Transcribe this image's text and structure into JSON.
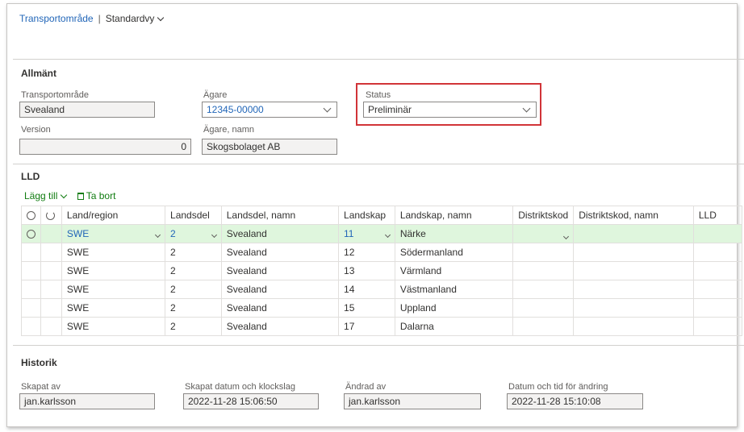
{
  "breadcrumb": {
    "entity": "Transportområde",
    "separator": "|",
    "view": "Standardvy"
  },
  "general": {
    "title": "Allmänt",
    "transport_area": {
      "label": "Transportområde",
      "value": "Svealand"
    },
    "version": {
      "label": "Version",
      "value": "0"
    },
    "owner": {
      "label": "Ägare",
      "value": "12345-00000"
    },
    "owner_name": {
      "label": "Ägare, namn",
      "value": "Skogsbolaget AB"
    },
    "status": {
      "label": "Status",
      "value": "Preliminär"
    }
  },
  "lld": {
    "title": "LLD",
    "toolbar": {
      "add": "Lägg till",
      "remove": "Ta bort"
    },
    "columns": [
      "Land/region",
      "Landsdel",
      "Landsdel, namn",
      "Landskap",
      "Landskap, namn",
      "Distriktskod",
      "Distriktskod, namn",
      "LLD"
    ],
    "rows": [
      {
        "country": "SWE",
        "part": "2",
        "part_name": "Svealand",
        "province": "11",
        "province_name": "Närke",
        "district": "",
        "district_name": "",
        "lld": ""
      },
      {
        "country": "SWE",
        "part": "2",
        "part_name": "Svealand",
        "province": "12",
        "province_name": "Södermanland",
        "district": "",
        "district_name": "",
        "lld": ""
      },
      {
        "country": "SWE",
        "part": "2",
        "part_name": "Svealand",
        "province": "13",
        "province_name": "Värmland",
        "district": "",
        "district_name": "",
        "lld": ""
      },
      {
        "country": "SWE",
        "part": "2",
        "part_name": "Svealand",
        "province": "14",
        "province_name": "Västmanland",
        "district": "",
        "district_name": "",
        "lld": ""
      },
      {
        "country": "SWE",
        "part": "2",
        "part_name": "Svealand",
        "province": "15",
        "province_name": "Uppland",
        "district": "",
        "district_name": "",
        "lld": ""
      },
      {
        "country": "SWE",
        "part": "2",
        "part_name": "Svealand",
        "province": "17",
        "province_name": "Dalarna",
        "district": "",
        "district_name": "",
        "lld": ""
      }
    ]
  },
  "history": {
    "title": "Historik",
    "created_by": {
      "label": "Skapat av",
      "value": "jan.karlsson"
    },
    "created_at": {
      "label": "Skapat datum och klockslag",
      "value": "2022-11-28 15:06:50"
    },
    "modified_by": {
      "label": "Ändrad av",
      "value": "jan.karlsson"
    },
    "modified_at": {
      "label": "Datum och tid för ändring",
      "value": "2022-11-28 15:10:08"
    }
  },
  "colors": {
    "link": "#2266b8",
    "accent_green": "#107c10",
    "selected_row": "#dff6dd",
    "highlight": "#d13438"
  }
}
